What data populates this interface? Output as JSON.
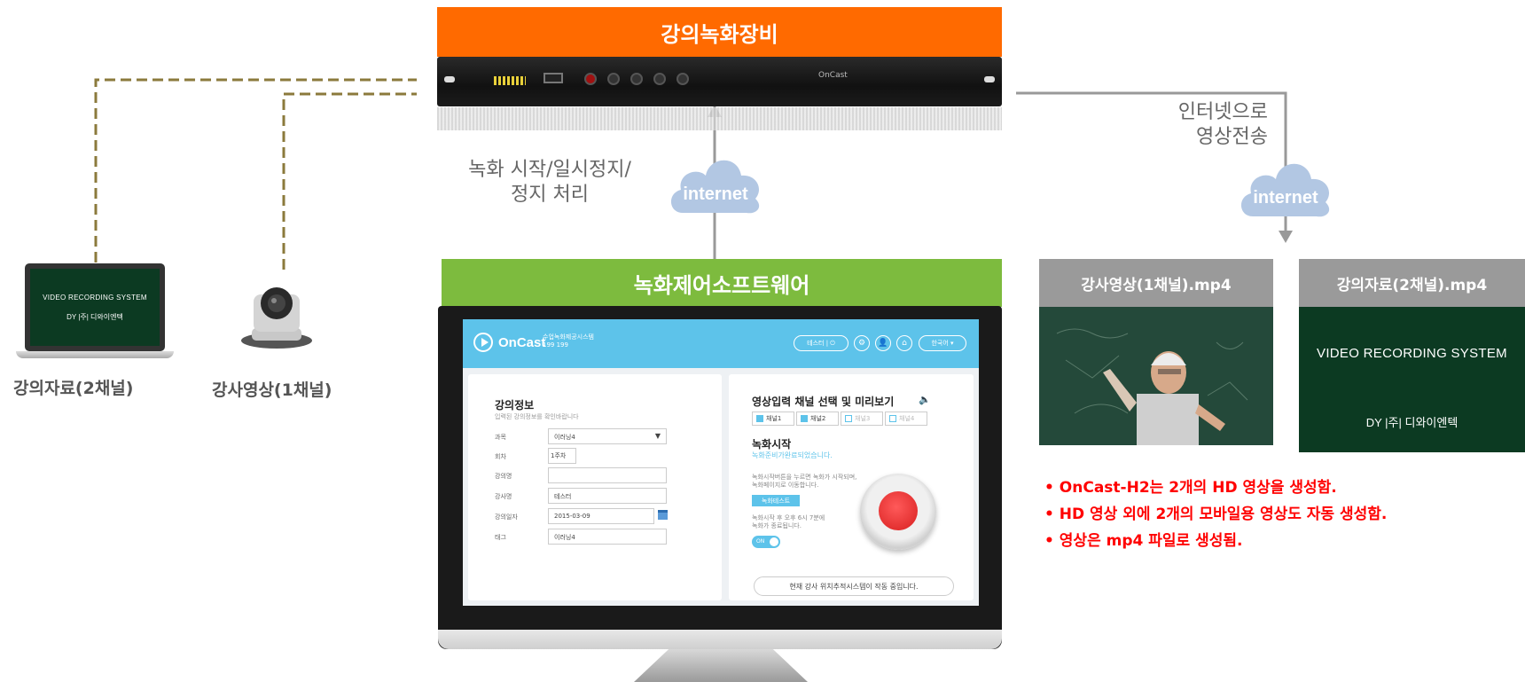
{
  "headers": {
    "recording_device": "강의녹화장비",
    "recording_software": "녹화제어소프트웨어"
  },
  "colors": {
    "device_header": "#ff6a00",
    "software_header": "#7dbb3e",
    "output_header": "#9a9a9a",
    "note_text": "#ff0000",
    "cloud": "#b2c7e3",
    "dashed_line": "#8b7a3c"
  },
  "hardware": {
    "brand": "OnCast"
  },
  "sources": {
    "material_label": "강의자료(2채널)",
    "lecturer_label": "강사영상(1채널)",
    "laptop_screen_title": "VIDEO RECORDING SYSTEM",
    "laptop_screen_logo": "DY |주| 디와이엔텍"
  },
  "control": {
    "text_line1": "녹화 시작/일시정지/",
    "text_line2": "정지 처리",
    "cloud_label": "internet"
  },
  "upload": {
    "text_line1": "인터넷으로",
    "text_line2": "영상전송",
    "cloud_label": "internet"
  },
  "app": {
    "logo": "OnCast",
    "subtitle_line1": "수업녹화제공시스템",
    "subtitle_line2": "199 199",
    "user_pill": "테스터 | ⏻",
    "lang_pill": "한국어 ▾",
    "gear_icon_glyph": "⚙",
    "user_icon_glyph": "👤",
    "home_icon_glyph": "⌂",
    "lecture_info": {
      "title": "강의정보",
      "subtitle": "입력된 강의정보를 확인바랍니다",
      "fields": [
        {
          "label": "과목",
          "value": "이러닝4"
        },
        {
          "label": "회차",
          "value": "1주차"
        },
        {
          "label": "강의명",
          "value": ""
        },
        {
          "label": "강사명",
          "value": "테스터"
        },
        {
          "label": "강의일자",
          "value": "2015-03-09"
        },
        {
          "label": "태그",
          "value": "이러닝4"
        }
      ]
    },
    "input_select": {
      "title": "영상입력 채널 선택 및 미리보기",
      "channels": [
        {
          "label": "채널1",
          "checked": true
        },
        {
          "label": "채널2",
          "checked": true
        },
        {
          "label": "채널3",
          "checked": false
        },
        {
          "label": "채널4",
          "checked": false
        }
      ],
      "rec_title": "녹화시작",
      "rec_status": "녹화준비가완료되었습니다.",
      "rec_desc_line1": "녹화시작버튼을 누르면 녹화가 시작되며,",
      "rec_desc_line2": "녹화페이지로 이동합니다.",
      "test_button": "녹화테스트",
      "auto_stop_line1": "녹화시작 후 오후 6시 7분에",
      "auto_stop_line2": "녹화가 종료됩니다.",
      "toggle_label": "ON",
      "status_bar": "현재 강사 위치추적시스템이 작동 중입니다."
    }
  },
  "outputs": {
    "lecturer_file": "강사영상(1채널).mp4",
    "material_file": "강의자료(2채널).mp4",
    "material_screen_title": "VIDEO RECORDING SYSTEM",
    "material_screen_logo": "DY |주| 디와이엔텍"
  },
  "notes": [
    "• OnCast-H2는 2개의 HD 영상을 생성함.",
    "• HD 영상 외에 2개의 모바일용 영상도 자동 생성함.",
    "• 영상은 mp4 파일로 생성됨."
  ]
}
